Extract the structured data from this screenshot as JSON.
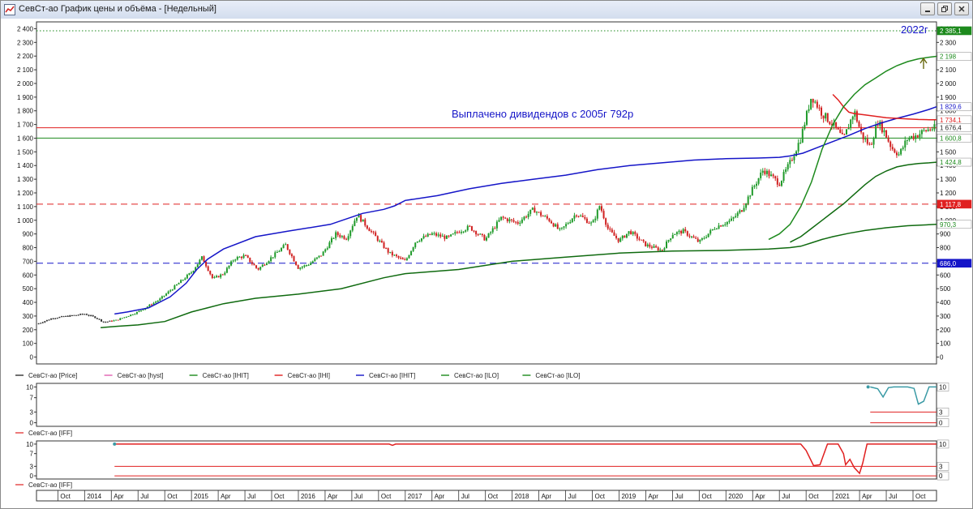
{
  "window": {
    "title": "СевСт-ао График цены и объёма - [Недельный]"
  },
  "colors": {
    "price_up": "#1f9a2a",
    "price_down": "#d02020",
    "blue": "#1515c8",
    "red": "#e02020",
    "green": "#1d8a1d",
    "green_dark": "#0f6a0f",
    "teal": "#3a9aa5"
  },
  "icons": [
    "chart-app-icon",
    "minimize-icon",
    "restore-icon",
    "close-icon",
    "up-arrow-icon"
  ],
  "annotations": {
    "year": "2022г",
    "dividends": "Выплачено дивидендов с 2005г 792р"
  },
  "legend_main": [
    {
      "label": "СевСт-ао [Price]",
      "color": "#333333"
    },
    {
      "label": "СевСт-ао [hyst]",
      "color": "#e060b0"
    },
    {
      "label": "СевСт-ао [IHIT]",
      "color": "#1d8a1d"
    },
    {
      "label": "СевСт-ао [IHI]",
      "color": "#e02020"
    },
    {
      "label": "СевСт-ао [IHIT]",
      "color": "#1515c8"
    },
    {
      "label": "СевСт-ао [ILO]",
      "color": "#1d8a1d"
    },
    {
      "label": "СевСт-ао [ILO]",
      "color": "#1d8a1d"
    }
  ],
  "legend_ind1": "СевСт-ао [IFF]",
  "legend_ind2": "СевСт-ао [IFF]",
  "chart_data": {
    "type": "line",
    "y_axis": {
      "ylim": [
        -50,
        2450
      ],
      "ticks": [
        0,
        100,
        200,
        300,
        400,
        500,
        600,
        700,
        800,
        900,
        1000,
        1100,
        1200,
        1300,
        1400,
        1500,
        1600,
        1700,
        1800,
        1900,
        2000,
        2100,
        2200,
        2300,
        2400
      ],
      "tick_labels": [
        "0",
        "100",
        "200",
        "300",
        "400",
        "500",
        "600",
        "700",
        "800",
        "900",
        "1 000",
        "1 100",
        "1 200",
        "1 300",
        "1 400",
        "1 500",
        "1 600",
        "1 700",
        "1 800",
        "1 900",
        "2 000",
        "2 100",
        "2 200",
        "2 300",
        "2 400"
      ]
    },
    "xlim": [
      2013.55,
      2021.97
    ],
    "x_ticks": [
      {
        "t": 2013.75,
        "label": "Oct"
      },
      {
        "t": 2014.0,
        "label": "2014"
      },
      {
        "t": 2014.25,
        "label": "Apr"
      },
      {
        "t": 2014.5,
        "label": "Jul"
      },
      {
        "t": 2014.75,
        "label": "Oct"
      },
      {
        "t": 2015.0,
        "label": "2015"
      },
      {
        "t": 2015.25,
        "label": "Apr"
      },
      {
        "t": 2015.5,
        "label": "Jul"
      },
      {
        "t": 2015.75,
        "label": "Oct"
      },
      {
        "t": 2016.0,
        "label": "2016"
      },
      {
        "t": 2016.25,
        "label": "Apr"
      },
      {
        "t": 2016.5,
        "label": "Jul"
      },
      {
        "t": 2016.75,
        "label": "Oct"
      },
      {
        "t": 2017.0,
        "label": "2017"
      },
      {
        "t": 2017.25,
        "label": "Apr"
      },
      {
        "t": 2017.5,
        "label": "Jul"
      },
      {
        "t": 2017.75,
        "label": "Oct"
      },
      {
        "t": 2018.0,
        "label": "2018"
      },
      {
        "t": 2018.25,
        "label": "Apr"
      },
      {
        "t": 2018.5,
        "label": "Jul"
      },
      {
        "t": 2018.75,
        "label": "Oct"
      },
      {
        "t": 2019.0,
        "label": "2019"
      },
      {
        "t": 2019.25,
        "label": "Apr"
      },
      {
        "t": 2019.5,
        "label": "Jul"
      },
      {
        "t": 2019.75,
        "label": "Oct"
      },
      {
        "t": 2020.0,
        "label": "2020"
      },
      {
        "t": 2020.25,
        "label": "Apr"
      },
      {
        "t": 2020.5,
        "label": "Jul"
      },
      {
        "t": 2020.75,
        "label": "Oct"
      },
      {
        "t": 2021.0,
        "label": "2021"
      },
      {
        "t": 2021.25,
        "label": "Apr"
      },
      {
        "t": 2021.5,
        "label": "Jul"
      },
      {
        "t": 2021.75,
        "label": "Oct"
      }
    ],
    "horizontal_lines": [
      {
        "value": 2385.1,
        "color": "#1d8a1d",
        "style": "dotted"
      },
      {
        "value": 1676.4,
        "color": "#e02020",
        "style": "solid"
      },
      {
        "value": 1600.8,
        "color": "#1d8a1d",
        "style": "solid"
      },
      {
        "value": 1117.8,
        "color": "#e02020",
        "style": "dashed"
      },
      {
        "value": 686.0,
        "color": "#1515c8",
        "style": "dashed"
      }
    ],
    "price_labels": [
      {
        "value": 2385.1,
        "label": "2 385,1",
        "bg": "#1d8a1d",
        "fg": "#ffffff"
      },
      {
        "value": 2198,
        "label": "2 198",
        "bg": "#ffffff",
        "fg": "#1d8a1d"
      },
      {
        "value": 1829.6,
        "label": "1 829,6",
        "bg": "#ffffff",
        "fg": "#1515c8"
      },
      {
        "value": 1734.1,
        "label": "1 734,1",
        "bg": "#ffffff",
        "fg": "#e02020"
      },
      {
        "value": 1676.4,
        "label": "1 676,4",
        "bg": "#ffffff",
        "fg": "#222222"
      },
      {
        "value": 1600.8,
        "label": "1 600,8",
        "bg": "#ffffff",
        "fg": "#1d8a1d"
      },
      {
        "value": 1424.8,
        "label": "1 424,8",
        "bg": "#ffffff",
        "fg": "#1d8a1d"
      },
      {
        "value": 1117.8,
        "label": "1 117,8",
        "bg": "#e02020",
        "fg": "#ffffff"
      },
      {
        "value": 970.3,
        "label": "970,3",
        "bg": "#ffffff",
        "fg": "#1d8a1d"
      },
      {
        "value": 686.0,
        "label": "686,0",
        "bg": "#1515c8",
        "fg": "#ffffff"
      }
    ],
    "series": [
      {
        "name": "СевСт-ао [Price]",
        "kind": "price",
        "x": [
          2013.55,
          2013.7,
          2013.85,
          2014.0,
          2014.1,
          2014.18,
          2014.3,
          2014.5,
          2014.7,
          2014.85,
          2015.0,
          2015.1,
          2015.2,
          2015.3,
          2015.4,
          2015.5,
          2015.62,
          2015.75,
          2015.88,
          2016.0,
          2016.1,
          2016.22,
          2016.35,
          2016.45,
          2016.55,
          2016.7,
          2016.85,
          2017.0,
          2017.1,
          2017.25,
          2017.4,
          2017.5,
          2017.6,
          2017.75,
          2017.9,
          2018.05,
          2018.2,
          2018.25,
          2018.35,
          2018.45,
          2018.6,
          2018.75,
          2018.82,
          2018.9,
          2019.0,
          2019.1,
          2019.25,
          2019.4,
          2019.5,
          2019.6,
          2019.75,
          2019.9,
          2020.05,
          2020.15,
          2020.25,
          2020.35,
          2020.5,
          2020.6,
          2020.7,
          2020.8,
          2020.9,
          2021.0,
          2021.1,
          2021.2,
          2021.27,
          2021.35,
          2021.42,
          2021.48,
          2021.55,
          2021.62,
          2021.7,
          2021.78,
          2021.85,
          2021.92,
          2021.97
        ],
        "y": [
          240,
          285,
          300,
          315,
          290,
          255,
          270,
          330,
          420,
          520,
          620,
          730,
          570,
          610,
          720,
          740,
          640,
          730,
          820,
          650,
          680,
          750,
          900,
          870,
          1040,
          900,
          760,
          700,
          850,
          900,
          870,
          920,
          950,
          860,
          1020,
          980,
          1080,
          1050,
          1000,
          920,
          1050,
          970,
          1110,
          930,
          850,
          920,
          820,
          780,
          900,
          920,
          840,
          950,
          1000,
          1080,
          1230,
          1370,
          1270,
          1420,
          1600,
          1910,
          1780,
          1700,
          1590,
          1800,
          1620,
          1540,
          1720,
          1650,
          1530,
          1480,
          1600,
          1620,
          1650,
          1670,
          1676
        ]
      },
      {
        "name": "СевСт-ао [IHIT]",
        "kind": "blue",
        "x": [
          2014.28,
          2014.4,
          2014.6,
          2014.8,
          2014.95,
          2015.05,
          2015.15,
          2015.3,
          2015.6,
          2015.9,
          2016.3,
          2016.6,
          2016.8,
          2016.9,
          2017.0,
          2017.3,
          2017.6,
          2017.9,
          2018.2,
          2018.5,
          2018.8,
          2019.1,
          2019.4,
          2019.7,
          2020.0,
          2020.3,
          2020.5,
          2020.6,
          2020.72,
          2020.85,
          2021.0,
          2021.15,
          2021.3,
          2021.45,
          2021.6,
          2021.75,
          2021.9,
          2021.97
        ],
        "y": [
          315,
          330,
          360,
          440,
          540,
          640,
          715,
          790,
          880,
          920,
          970,
          1050,
          1080,
          1105,
          1145,
          1180,
          1230,
          1270,
          1300,
          1330,
          1370,
          1400,
          1420,
          1440,
          1450,
          1455,
          1460,
          1470,
          1490,
          1530,
          1575,
          1620,
          1670,
          1710,
          1745,
          1775,
          1810,
          1829.6
        ]
      },
      {
        "name": "СевСт-ао [IHI]",
        "kind": "red",
        "x": [
          2021.0,
          2021.05,
          2021.1,
          2021.15,
          2021.2,
          2021.3,
          2021.4,
          2021.5,
          2021.6,
          2021.7,
          2021.8,
          2021.9,
          2021.97
        ],
        "y": [
          1920,
          1880,
          1830,
          1790,
          1780,
          1770,
          1760,
          1750,
          1745,
          1740,
          1737,
          1735,
          1734.1
        ]
      },
      {
        "name": "СевСт-ао [ILO]",
        "kind": "green_low",
        "x": [
          2013.55,
          2013.75,
          2014.0,
          2014.15,
          2014.3,
          2014.5,
          2014.75,
          2015.0,
          2015.3,
          2015.6,
          2016.0,
          2016.4,
          2016.8,
          2017.0,
          2017.5,
          2018.0,
          2018.5,
          2019.0,
          2019.5,
          2020.0,
          2020.4,
          2020.6,
          2020.7,
          2020.8,
          2020.9,
          2021.0,
          2021.15,
          2021.3,
          2021.5,
          2021.7,
          2021.97
        ],
        "y": [
          null,
          null,
          null,
          215,
          225,
          235,
          260,
          330,
          390,
          430,
          460,
          500,
          580,
          610,
          640,
          700,
          730,
          760,
          775,
          780,
          790,
          800,
          810,
          835,
          860,
          880,
          905,
          925,
          945,
          960,
          970.3
        ]
      },
      {
        "name": "СевСт-ао [ILO]",
        "kind": "green_mid",
        "x": [
          2020.6,
          2020.7,
          2020.8,
          2020.9,
          2021.0,
          2021.1,
          2021.2,
          2021.3,
          2021.4,
          2021.5,
          2021.6,
          2021.7,
          2021.8,
          2021.9,
          2021.97
        ],
        "y": [
          840,
          880,
          940,
          1000,
          1060,
          1120,
          1190,
          1260,
          1320,
          1360,
          1390,
          1405,
          1415,
          1420,
          1424.8
        ]
      },
      {
        "name": "СевСт-ао [IHIT]",
        "kind": "green_high",
        "x": [
          2020.4,
          2020.5,
          2020.6,
          2020.7,
          2020.8,
          2020.9,
          2021.0,
          2021.1,
          2021.2,
          2021.3,
          2021.4,
          2021.5,
          2021.6,
          2021.7,
          2021.8,
          2021.9,
          2021.97
        ],
        "y": [
          860,
          900,
          970,
          1100,
          1280,
          1520,
          1700,
          1830,
          1920,
          1990,
          2040,
          2090,
          2130,
          2160,
          2180,
          2192,
          2198
        ]
      }
    ],
    "indicator1": {
      "ylim": [
        -1,
        11
      ],
      "ticks": [
        0,
        3,
        7,
        10
      ],
      "tick_labels": [
        "0",
        "3",
        "7",
        "10"
      ],
      "right_labels": [
        {
          "value": 10,
          "label": "10"
        },
        {
          "value": 3,
          "label": "3"
        },
        {
          "value": 0,
          "label": "0"
        }
      ],
      "x": [
        2021.35,
        2021.42,
        2021.47,
        2021.52,
        2021.57,
        2021.62,
        2021.7,
        2021.76,
        2021.8,
        2021.85,
        2021.9,
        2021.97
      ],
      "y": [
        10,
        9.5,
        7.2,
        9.8,
        10,
        10,
        10,
        9.6,
        5.2,
        6.0,
        10,
        10
      ],
      "start_marker": {
        "x": 2021.33,
        "y": 10
      },
      "level_lines": [
        {
          "value": 3,
          "from": 2021.35
        },
        {
          "value": 0,
          "from": 2021.35
        }
      ]
    },
    "indicator2": {
      "ylim": [
        -1,
        11
      ],
      "ticks": [
        0,
        3,
        7,
        10
      ],
      "tick_labels": [
        "0",
        "3",
        "7",
        "10"
      ],
      "right_labels": [
        {
          "value": 10,
          "label": "10"
        },
        {
          "value": 3,
          "label": "3"
        },
        {
          "value": 0,
          "label": "0"
        }
      ],
      "x": [
        2014.28,
        2016.85,
        2016.88,
        2016.91,
        2020.7,
        2020.75,
        2020.82,
        2020.88,
        2020.95,
        2021.05,
        2021.1,
        2021.12,
        2021.16,
        2021.2,
        2021.25,
        2021.28,
        2021.32,
        2021.4,
        2021.97
      ],
      "y": [
        10,
        10,
        9.6,
        10,
        10,
        8,
        3.2,
        3.5,
        10,
        10,
        7,
        3.5,
        5.2,
        2.6,
        0.8,
        4,
        10,
        10,
        10
      ],
      "start_marker": {
        "x": 2014.28,
        "y": 10
      },
      "level_lines": [
        {
          "value": 3,
          "from": 2014.28
        },
        {
          "value": 0,
          "from": 2014.28
        }
      ]
    }
  }
}
